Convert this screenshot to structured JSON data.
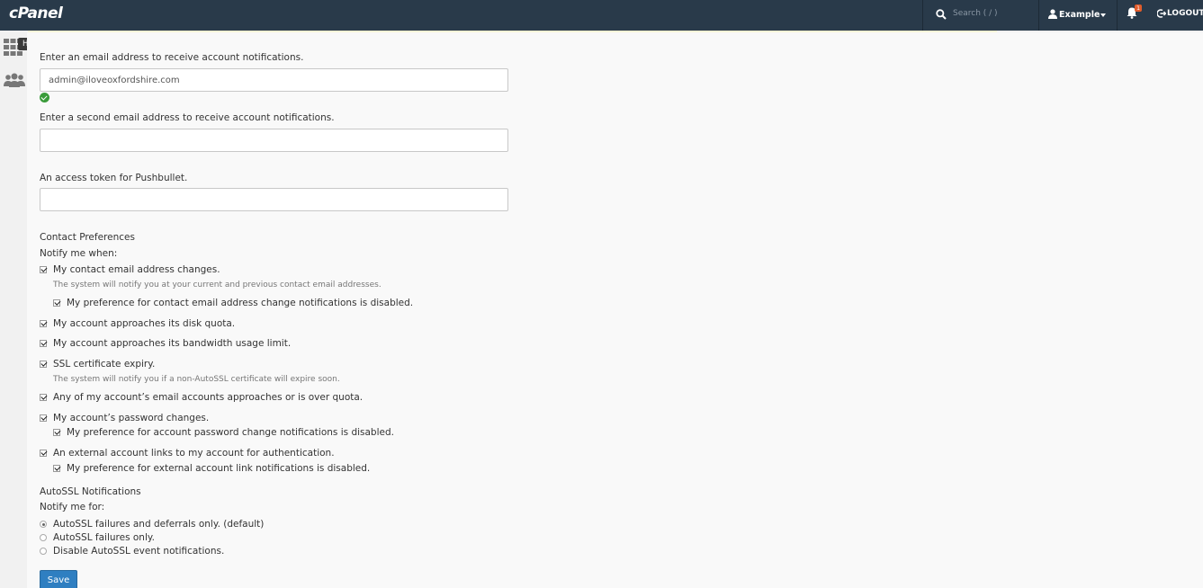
{
  "header": {
    "logo": "cPanel",
    "search_placeholder": "Search ( / )",
    "user": "Example",
    "notification_count": "1",
    "logout": "LOGOUT"
  },
  "sidebar": {
    "tooltip": "Home"
  },
  "form": {
    "email1_label": "Enter an email address to receive account notifications.",
    "email1_value": "admin@iloveoxfordshire.com",
    "email2_label": "Enter a second email address to receive account notifications.",
    "email2_value": "",
    "pushbullet_label": "An access token for Pushbullet.",
    "pushbullet_value": ""
  },
  "contact": {
    "title": "Contact Preferences",
    "notify": "Notify me when:",
    "items": [
      {
        "label": "My contact email address changes.",
        "checked": true
      },
      {
        "label": "The system will notify you at your current and previous contact email addresses."
      },
      {
        "label": "My preference for contact email address change notifications is disabled.",
        "checked": true
      },
      {
        "label": "My account approaches its disk quota.",
        "checked": true
      },
      {
        "label": "My account approaches its bandwidth usage limit.",
        "checked": true
      },
      {
        "label": "SSL certificate expiry.",
        "checked": true
      },
      {
        "label": "The system will notify you if a non-AutoSSL certificate will expire soon."
      },
      {
        "label": "Any of my account’s email accounts approaches or is over quota.",
        "checked": true
      },
      {
        "label": "My account’s password changes.",
        "checked": true
      },
      {
        "label": "My preference for account password change notifications is disabled.",
        "checked": true
      },
      {
        "label": "An external account links to my account for authentication.",
        "checked": true
      },
      {
        "label": "My preference for external account link notifications is disabled.",
        "checked": true
      }
    ]
  },
  "autossl": {
    "title": "AutoSSL Notifications",
    "notify": "Notify me for:",
    "options": [
      {
        "label": "AutoSSL failures and deferrals only. (default)",
        "selected": true
      },
      {
        "label": "AutoSSL failures only.",
        "selected": false
      },
      {
        "label": "Disable AutoSSL event notifications.",
        "selected": false
      }
    ]
  },
  "save_label": "Save",
  "colors": {
    "topbar": "#293a4a",
    "primary_button": "#2f7fc1",
    "success": "#3a9b3a"
  }
}
